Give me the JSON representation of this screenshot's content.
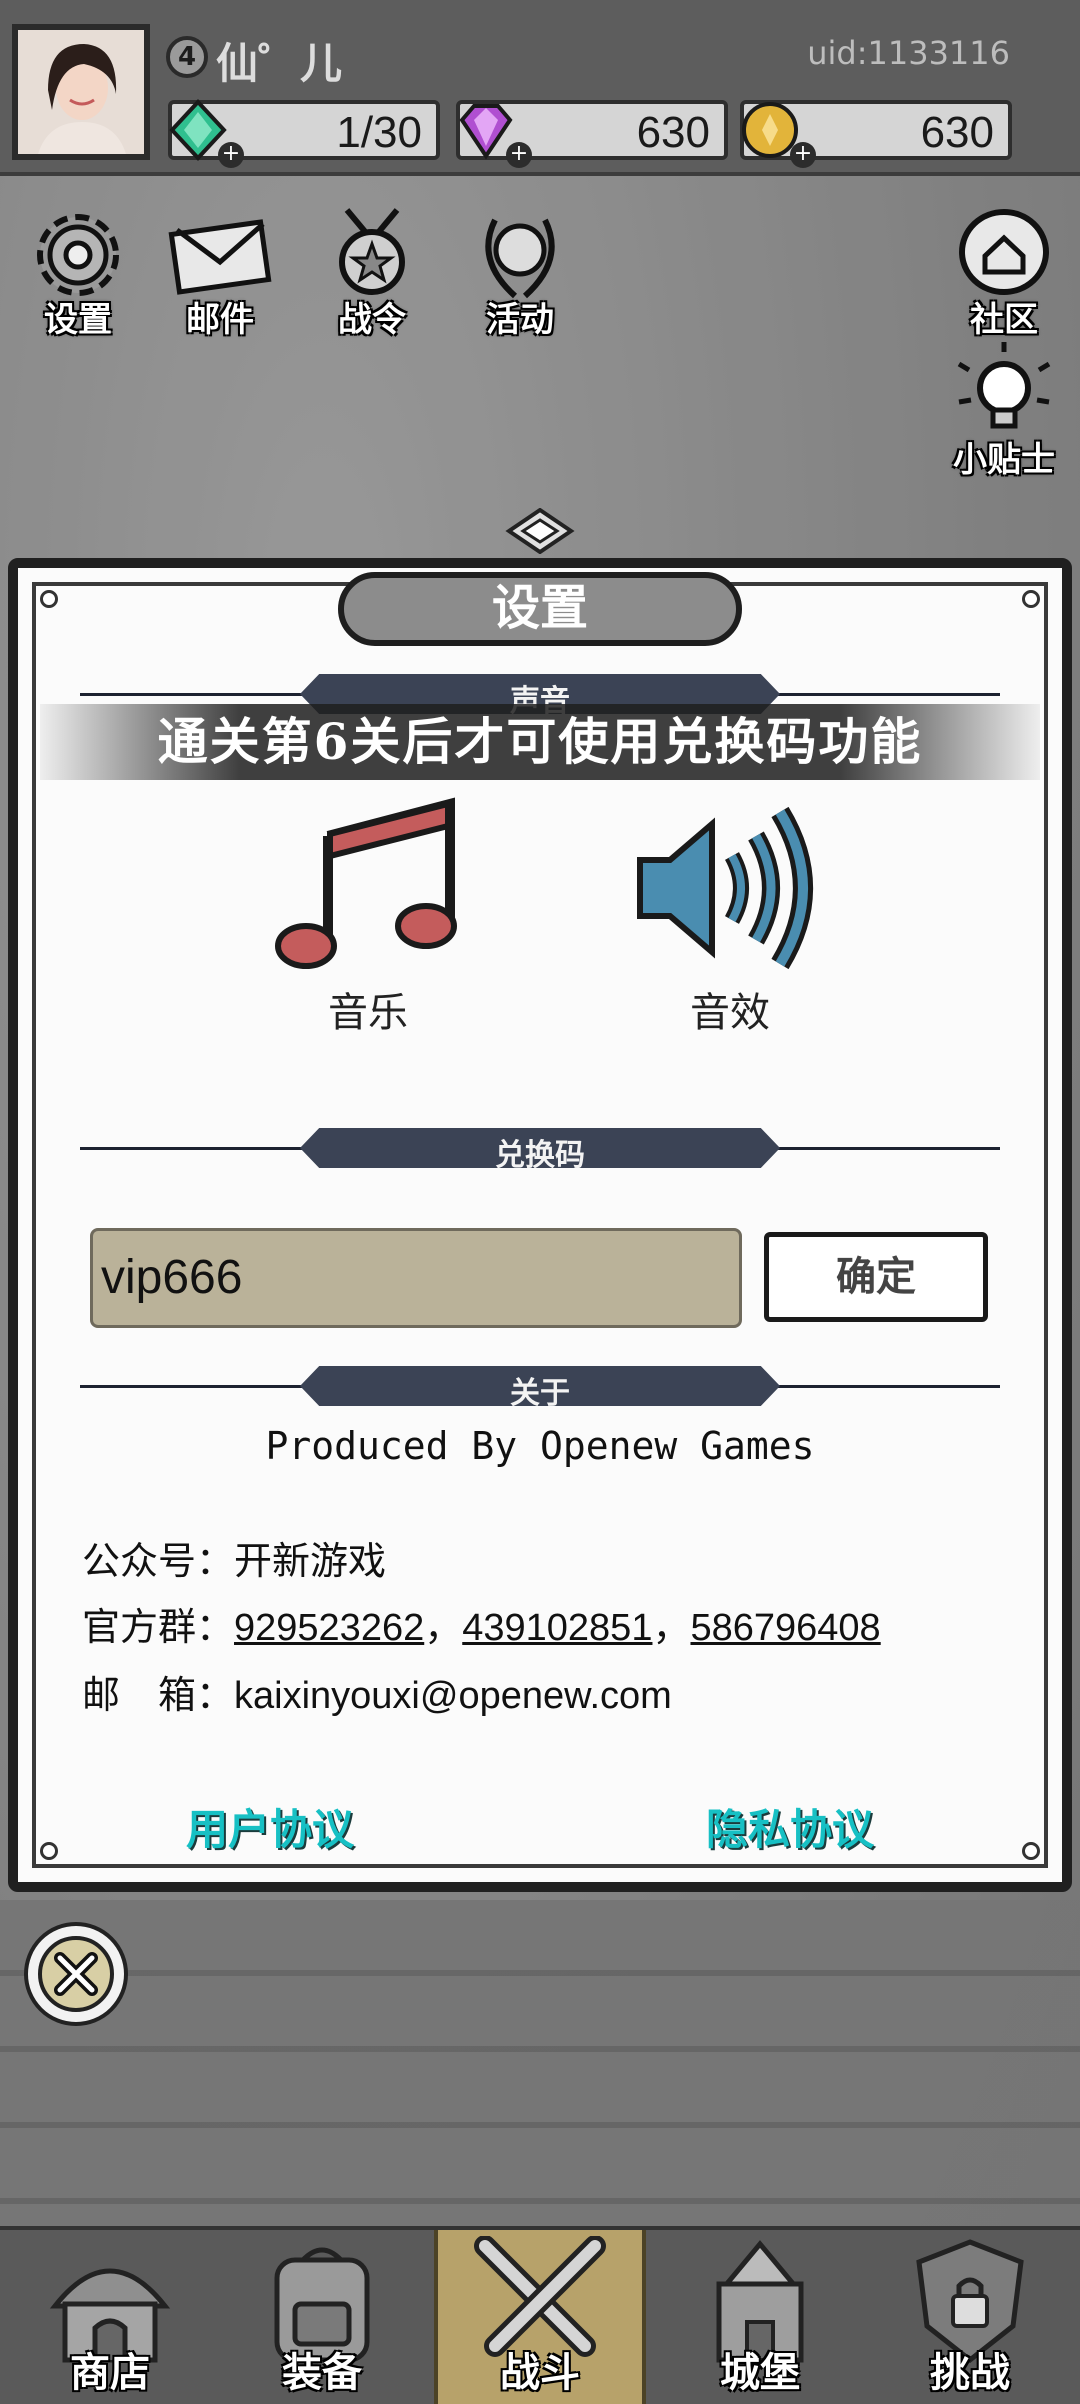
{
  "header": {
    "player_level": "4",
    "player_name": "仙゜儿",
    "uid": "uid:1133116",
    "resources": [
      {
        "icon": "green-gem-icon",
        "value": "1/30",
        "color": "#2fbf8f"
      },
      {
        "icon": "purple-diamond-icon",
        "value": "630",
        "color": "#b04fd1"
      },
      {
        "icon": "gold-coin-icon",
        "value": "630",
        "color": "#e2b43a"
      }
    ]
  },
  "top_menu": {
    "settings": "设置",
    "mail": "邮件",
    "battle_pass": "战令",
    "events": "活动",
    "community": "社区",
    "tips": "小贴士"
  },
  "modal": {
    "title": "设置",
    "section_sound": "声音",
    "banner": "通关第6关后才可使用兑换码功能",
    "music_label": "音乐",
    "sfx_label": "音效",
    "section_redeem": "兑换码",
    "redeem_code_value": "vip666",
    "confirm_label": "确定",
    "section_about": "关于",
    "produced_by": "Produced By Openew Games",
    "official_account_key": "公众号：",
    "official_account_value": "开新游戏",
    "official_group_key": "官方群：",
    "groups": [
      "929523262",
      "439102851",
      "586796408"
    ],
    "group_sep": "，",
    "email_key": "邮　箱：",
    "email_value": "kaixinyouxi@openew.com",
    "user_agreement": "用户协议",
    "privacy_agreement": "隐私协议"
  },
  "bottom_nav": {
    "shop": "商店",
    "equipment": "装备",
    "battle": "战斗",
    "castle": "城堡",
    "challenge": "挑战"
  },
  "colors": {
    "music_note": "#c45c5c",
    "speaker": "#4a8db0",
    "link_teal": "#17c0c4",
    "section_plate": "#3b4355",
    "input_bg": "#bab299"
  }
}
